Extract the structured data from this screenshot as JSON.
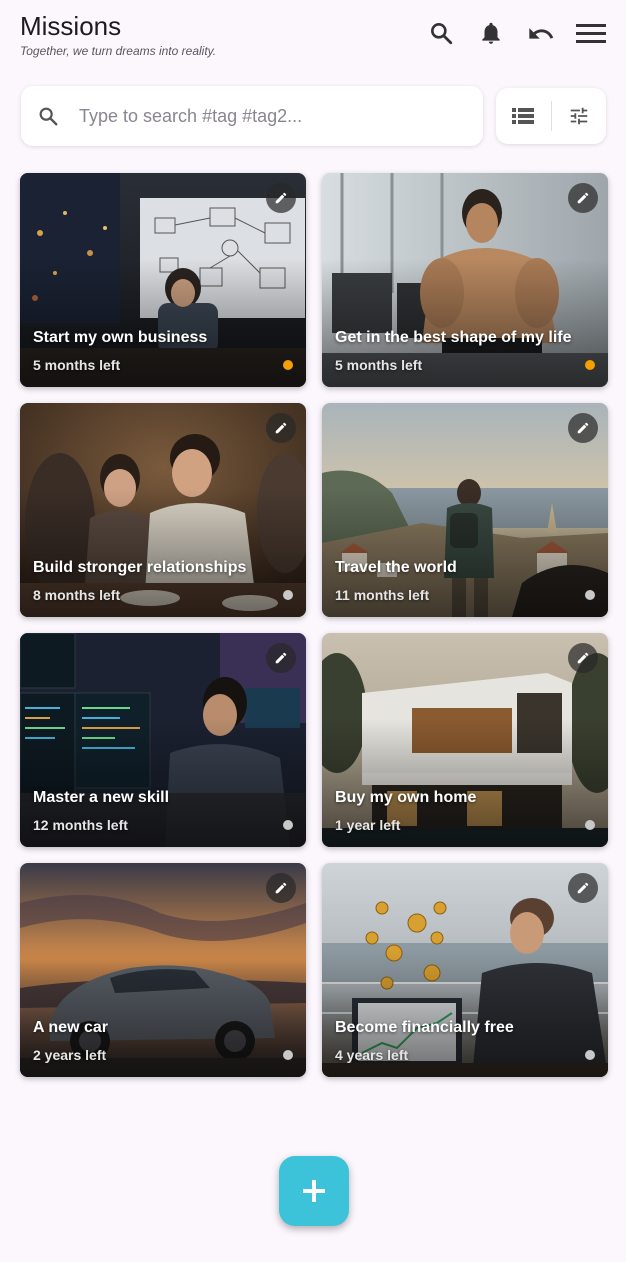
{
  "header": {
    "title": "Missions",
    "subtitle": "Together, we turn dreams into reality."
  },
  "search": {
    "placeholder": "Type to search #tag #tag2..."
  },
  "colors": {
    "accent": "#3cc3da",
    "status_active": "#f5a000",
    "status_idle": "#c8c8c8"
  },
  "missions": [
    {
      "title": "Start my own business",
      "time_left": "5 months left",
      "status": "active"
    },
    {
      "title": "Get in the best shape of my life",
      "time_left": "5 months left",
      "status": "active"
    },
    {
      "title": "Build stronger relationships",
      "time_left": "8 months left",
      "status": "idle"
    },
    {
      "title": "Travel the world",
      "time_left": "11 months left",
      "status": "idle"
    },
    {
      "title": "Master a new skill",
      "time_left": "12 months left",
      "status": "idle"
    },
    {
      "title": "Buy my own home",
      "time_left": "1 year left",
      "status": "idle"
    },
    {
      "title": "A new car",
      "time_left": "2 years left",
      "status": "idle"
    },
    {
      "title": "Become financially free",
      "time_left": "4 years left",
      "status": "idle"
    }
  ]
}
